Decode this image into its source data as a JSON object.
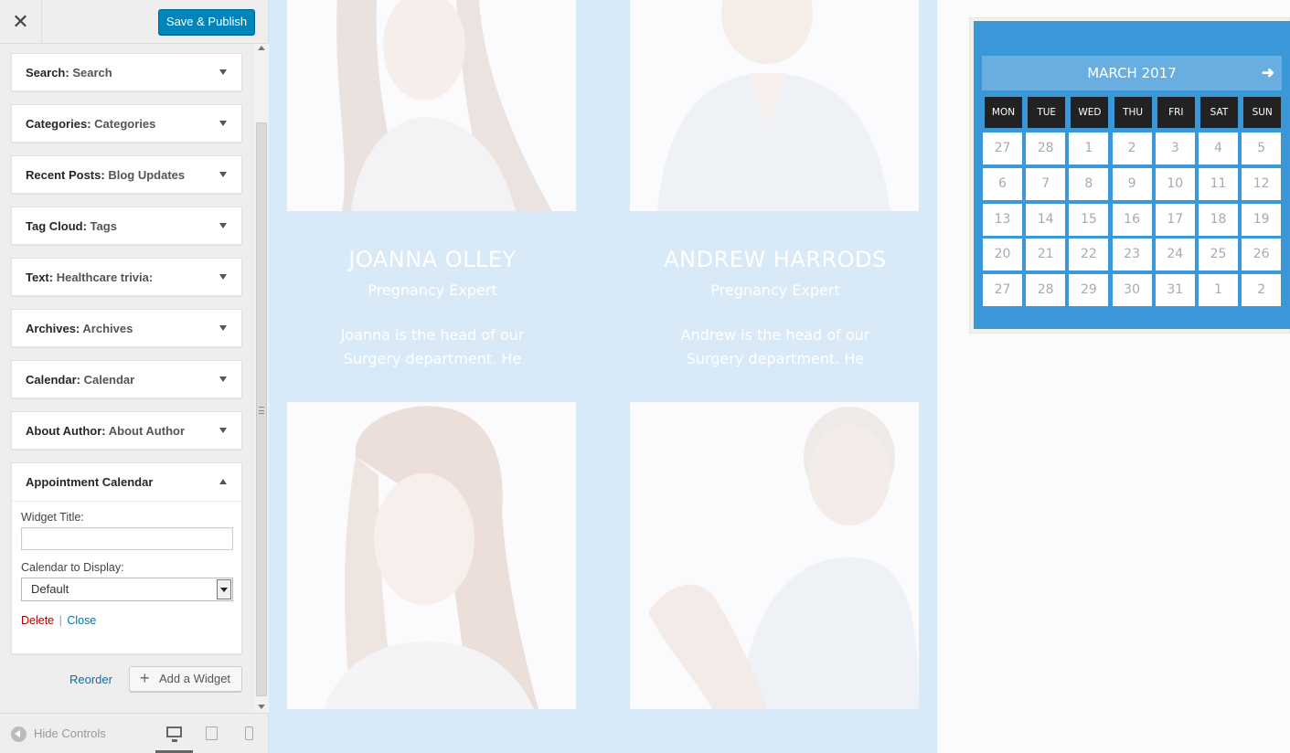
{
  "header": {
    "close_icon": "close-icon",
    "save_label": "Save & Publish"
  },
  "widgets": [
    {
      "type": "Search",
      "title": "Search"
    },
    {
      "type": "Categories",
      "title": "Categories"
    },
    {
      "type": "Recent Posts",
      "title": "Blog Updates"
    },
    {
      "type": "Tag Cloud",
      "title": "Tags"
    },
    {
      "type": "Text",
      "title": "Healthcare trivia:"
    },
    {
      "type": "Archives",
      "title": "Archives"
    },
    {
      "type": "Calendar",
      "title": "Calendar"
    },
    {
      "type": "About Author",
      "title": "About Author"
    }
  ],
  "open_widget": {
    "name": "Appointment Calendar",
    "widget_title_label": "Widget Title:",
    "widget_title_value": "",
    "calendar_label": "Calendar to Display:",
    "calendar_value": "Default",
    "delete_label": "Delete",
    "separator": "|",
    "close_label": "Close"
  },
  "actions": {
    "reorder_label": "Reorder",
    "add_widget_label": "Add a Widget"
  },
  "footer": {
    "hide_controls_label": "Hide Controls",
    "devices": [
      "desktop-icon",
      "tablet-icon",
      "mobile-icon"
    ],
    "active_device": "desktop"
  },
  "team": [
    {
      "name": "JOANNA OLLEY",
      "role": "Pregnancy Expert",
      "bio_line1": "Joanna is the head of our",
      "bio_line2": "Surgery department. He"
    },
    {
      "name": "ANDREW HARRODS",
      "role": "Pregnancy Expert",
      "bio_line1": "Andrew is the head of our",
      "bio_line2": "Surgery department. He"
    }
  ],
  "calendar": {
    "month_label": "MARCH 2017",
    "next_icon": "arrow-right-icon",
    "weekdays": [
      "MON",
      "TUE",
      "WED",
      "THU",
      "FRI",
      "SAT",
      "SUN"
    ],
    "weeks": [
      [
        27,
        28,
        1,
        2,
        3,
        4,
        5
      ],
      [
        6,
        7,
        8,
        9,
        10,
        11,
        12
      ],
      [
        13,
        14,
        15,
        16,
        17,
        18,
        19
      ],
      [
        20,
        21,
        22,
        23,
        24,
        25,
        26
      ],
      [
        27,
        28,
        29,
        30,
        31,
        1,
        2
      ]
    ]
  },
  "colors": {
    "primary_button": "#0085ba",
    "calendar_bg": "#3a97d8",
    "calendar_header": "#68aee0",
    "team_bg": "#d8e9f8",
    "delete_link": "#aa0000",
    "link": "#0073aa"
  }
}
